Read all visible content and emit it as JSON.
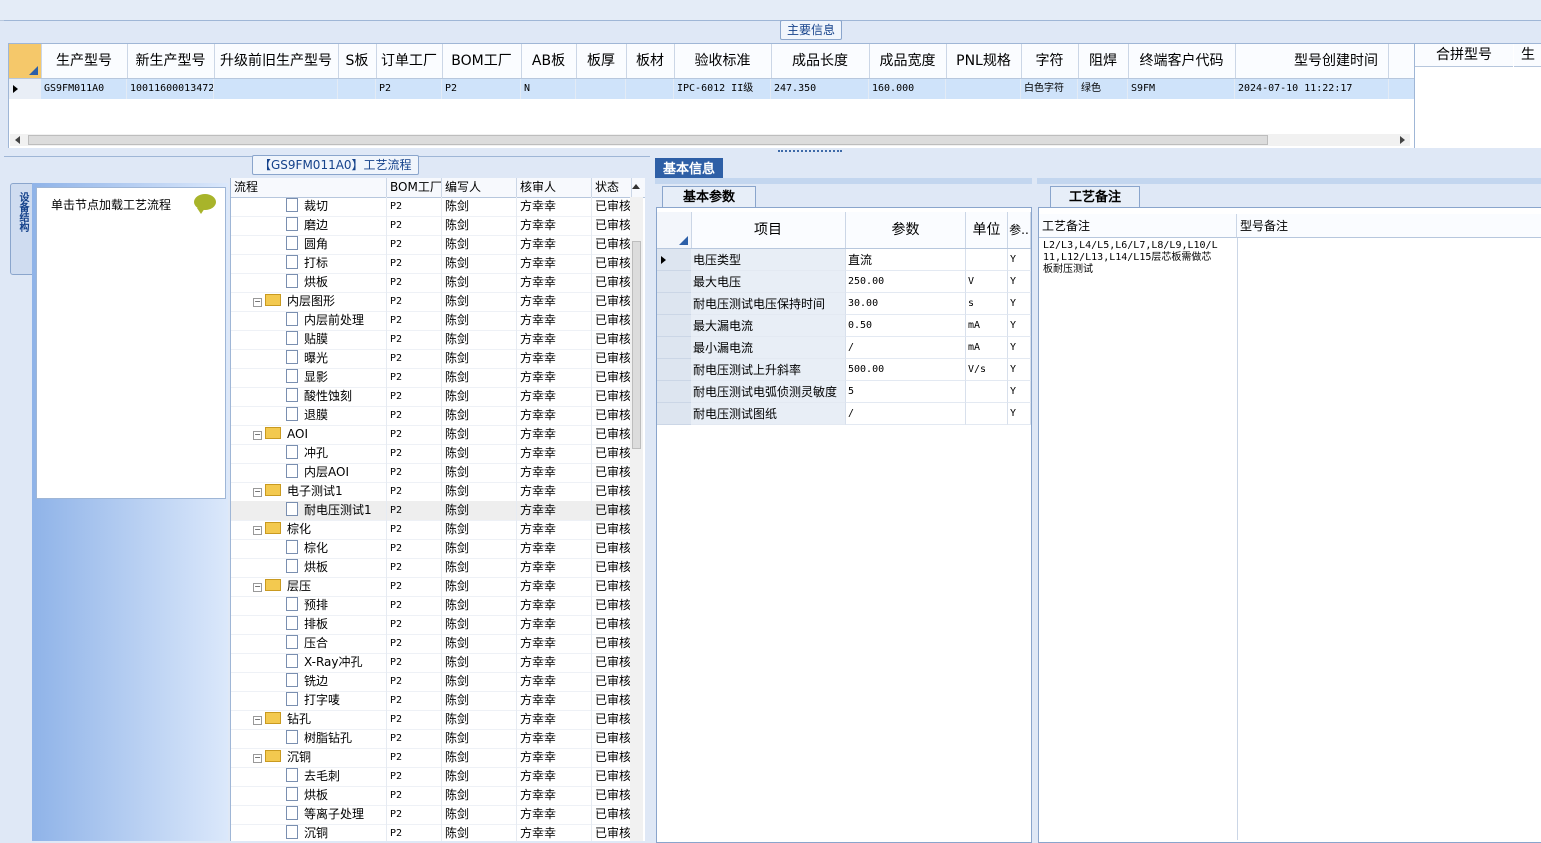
{
  "main_group_title": "主要信息",
  "main_table": {
    "columns": [
      "生产型号",
      "新生产型号",
      "升级前旧生产型号",
      "S板",
      "订单工厂",
      "BOM工厂",
      "AB板",
      "板厚",
      "板材",
      "验收标准",
      "成品长度",
      "成品宽度",
      "PNL规格",
      "字符",
      "阻焊",
      "终端客户代码",
      "型号创建时间"
    ],
    "row": [
      "GS9FM011A0",
      "10011600013472",
      "",
      "",
      "P2",
      "P2",
      "N",
      "",
      "",
      "IPC-6012 II级",
      "247.350",
      "160.000",
      "",
      "白色字符",
      "绿色",
      "S9FM",
      "2024-07-10 11:22:17"
    ],
    "side_columns": [
      "合拼型号",
      "生"
    ]
  },
  "flow_group_title": "【GS9FM011A0】工艺流程",
  "left_tab_label": "设备结构",
  "left_hint": "单击节点加载工艺流程",
  "tree": {
    "columns": [
      "流程",
      "BOM工厂",
      "编写人",
      "核审人",
      "状态"
    ],
    "rows": [
      {
        "name": "裁切",
        "level": 2,
        "bom": "P2",
        "writer": "陈剑",
        "reviewer": "方幸幸",
        "status": "已审核"
      },
      {
        "name": "磨边",
        "level": 2,
        "bom": "P2",
        "writer": "陈剑",
        "reviewer": "方幸幸",
        "status": "已审核"
      },
      {
        "name": "圆角",
        "level": 2,
        "bom": "P2",
        "writer": "陈剑",
        "reviewer": "方幸幸",
        "status": "已审核"
      },
      {
        "name": "打标",
        "level": 2,
        "bom": "P2",
        "writer": "陈剑",
        "reviewer": "方幸幸",
        "status": "已审核"
      },
      {
        "name": "烘板",
        "level": 2,
        "bom": "P2",
        "writer": "陈剑",
        "reviewer": "方幸幸",
        "status": "已审核"
      },
      {
        "name": "内层图形",
        "level": 1,
        "bom": "P2",
        "writer": "陈剑",
        "reviewer": "方幸幸",
        "status": "已审核"
      },
      {
        "name": "内层前处理",
        "level": 2,
        "bom": "P2",
        "writer": "陈剑",
        "reviewer": "方幸幸",
        "status": "已审核"
      },
      {
        "name": "贴膜",
        "level": 2,
        "bom": "P2",
        "writer": "陈剑",
        "reviewer": "方幸幸",
        "status": "已审核"
      },
      {
        "name": "曝光",
        "level": 2,
        "bom": "P2",
        "writer": "陈剑",
        "reviewer": "方幸幸",
        "status": "已审核"
      },
      {
        "name": "显影",
        "level": 2,
        "bom": "P2",
        "writer": "陈剑",
        "reviewer": "方幸幸",
        "status": "已审核"
      },
      {
        "name": "酸性蚀刻",
        "level": 2,
        "bom": "P2",
        "writer": "陈剑",
        "reviewer": "方幸幸",
        "status": "已审核"
      },
      {
        "name": "退膜",
        "level": 2,
        "bom": "P2",
        "writer": "陈剑",
        "reviewer": "方幸幸",
        "status": "已审核"
      },
      {
        "name": "AOI",
        "level": 1,
        "bom": "P2",
        "writer": "陈剑",
        "reviewer": "方幸幸",
        "status": "已审核"
      },
      {
        "name": "冲孔",
        "level": 2,
        "bom": "P2",
        "writer": "陈剑",
        "reviewer": "方幸幸",
        "status": "已审核"
      },
      {
        "name": "内层AOI",
        "level": 2,
        "bom": "P2",
        "writer": "陈剑",
        "reviewer": "方幸幸",
        "status": "已审核"
      },
      {
        "name": "电子测试1",
        "level": 1,
        "bom": "P2",
        "writer": "陈剑",
        "reviewer": "方幸幸",
        "status": "已审核"
      },
      {
        "name": "耐电压测试1",
        "level": 2,
        "bom": "P2",
        "writer": "陈剑",
        "reviewer": "方幸幸",
        "status": "已审核",
        "selected": true
      },
      {
        "name": "棕化",
        "level": 1,
        "bom": "P2",
        "writer": "陈剑",
        "reviewer": "方幸幸",
        "status": "已审核"
      },
      {
        "name": "棕化",
        "level": 2,
        "bom": "P2",
        "writer": "陈剑",
        "reviewer": "方幸幸",
        "status": "已审核"
      },
      {
        "name": "烘板",
        "level": 2,
        "bom": "P2",
        "writer": "陈剑",
        "reviewer": "方幸幸",
        "status": "已审核"
      },
      {
        "name": "层压",
        "level": 1,
        "bom": "P2",
        "writer": "陈剑",
        "reviewer": "方幸幸",
        "status": "已审核"
      },
      {
        "name": "预排",
        "level": 2,
        "bom": "P2",
        "writer": "陈剑",
        "reviewer": "方幸幸",
        "status": "已审核"
      },
      {
        "name": "排板",
        "level": 2,
        "bom": "P2",
        "writer": "陈剑",
        "reviewer": "方幸幸",
        "status": "已审核"
      },
      {
        "name": "压合",
        "level": 2,
        "bom": "P2",
        "writer": "陈剑",
        "reviewer": "方幸幸",
        "status": "已审核"
      },
      {
        "name": "X-Ray冲孔",
        "level": 2,
        "bom": "P2",
        "writer": "陈剑",
        "reviewer": "方幸幸",
        "status": "已审核"
      },
      {
        "name": "铣边",
        "level": 2,
        "bom": "P2",
        "writer": "陈剑",
        "reviewer": "方幸幸",
        "status": "已审核"
      },
      {
        "name": "打字唛",
        "level": 2,
        "bom": "P2",
        "writer": "陈剑",
        "reviewer": "方幸幸",
        "status": "已审核"
      },
      {
        "name": "钻孔",
        "level": 1,
        "bom": "P2",
        "writer": "陈剑",
        "reviewer": "方幸幸",
        "status": "已审核"
      },
      {
        "name": "树脂钻孔",
        "level": 2,
        "bom": "P2",
        "writer": "陈剑",
        "reviewer": "方幸幸",
        "status": "已审核"
      },
      {
        "name": "沉铜",
        "level": 1,
        "bom": "P2",
        "writer": "陈剑",
        "reviewer": "方幸幸",
        "status": "已审核"
      },
      {
        "name": "去毛刺",
        "level": 2,
        "bom": "P2",
        "writer": "陈剑",
        "reviewer": "方幸幸",
        "status": "已审核"
      },
      {
        "name": "烘板",
        "level": 2,
        "bom": "P2",
        "writer": "陈剑",
        "reviewer": "方幸幸",
        "status": "已审核"
      },
      {
        "name": "等离子处理",
        "level": 2,
        "bom": "P2",
        "writer": "陈剑",
        "reviewer": "方幸幸",
        "status": "已审核"
      },
      {
        "name": "沉铜",
        "level": 2,
        "bom": "P2",
        "writer": "陈剑",
        "reviewer": "方幸幸",
        "status": "已审核"
      }
    ]
  },
  "basic_tab": "基本信息",
  "param_tab": "基本参数",
  "remark_tab": "工艺备注",
  "param_table": {
    "columns": [
      "项目",
      "参数",
      "单位",
      "参.."
    ],
    "rows": [
      {
        "item": "电压类型",
        "value": "直流",
        "unit": "",
        "flag": "Y"
      },
      {
        "item": "最大电压",
        "value": "250.00",
        "unit": "V",
        "flag": "Y"
      },
      {
        "item": "耐电压测试电压保持时间",
        "value": "30.00",
        "unit": "s",
        "flag": "Y"
      },
      {
        "item": "最大漏电流",
        "value": "0.50",
        "unit": "mA",
        "flag": "Y"
      },
      {
        "item": "最小漏电流",
        "value": "/",
        "unit": "mA",
        "flag": "Y"
      },
      {
        "item": "耐电压测试上升斜率",
        "value": "500.00",
        "unit": "V/s",
        "flag": "Y"
      },
      {
        "item": "耐电压测试电弧侦测灵敏度",
        "value": "5",
        "unit": "",
        "flag": "Y"
      },
      {
        "item": "耐电压测试图纸",
        "value": "/",
        "unit": "",
        "flag": "Y"
      }
    ]
  },
  "remarks": {
    "col1": "工艺备注",
    "col2": "型号备注",
    "text": "L2/L3,L4/L5,L6/L7,L8/L9,L10/L11,L12/L13,L14/L15层芯板需做芯板耐压测试"
  }
}
